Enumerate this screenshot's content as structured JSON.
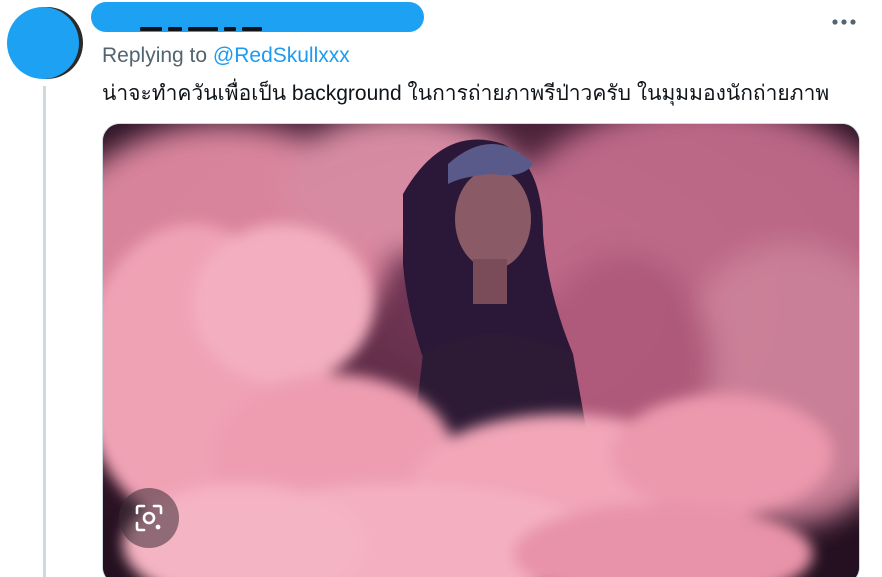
{
  "colors": {
    "accent": "#1d9bf0",
    "redaction": "#1da1f2",
    "secondary_text": "#536471",
    "primary_text": "#0f1419",
    "border": "#cfd9de"
  },
  "reply": {
    "prefix": "Replying to",
    "mention": "@RedSkullxxx"
  },
  "tweet": {
    "text": "น่าจะทำควันเพื่อเป็น background ในการถ่ายภาพรีป่าวครับ ในมุมมองนักถ่ายภาพ"
  },
  "icons": {
    "more": "more-horizontal-icon",
    "lens": "visual-search-icon"
  }
}
